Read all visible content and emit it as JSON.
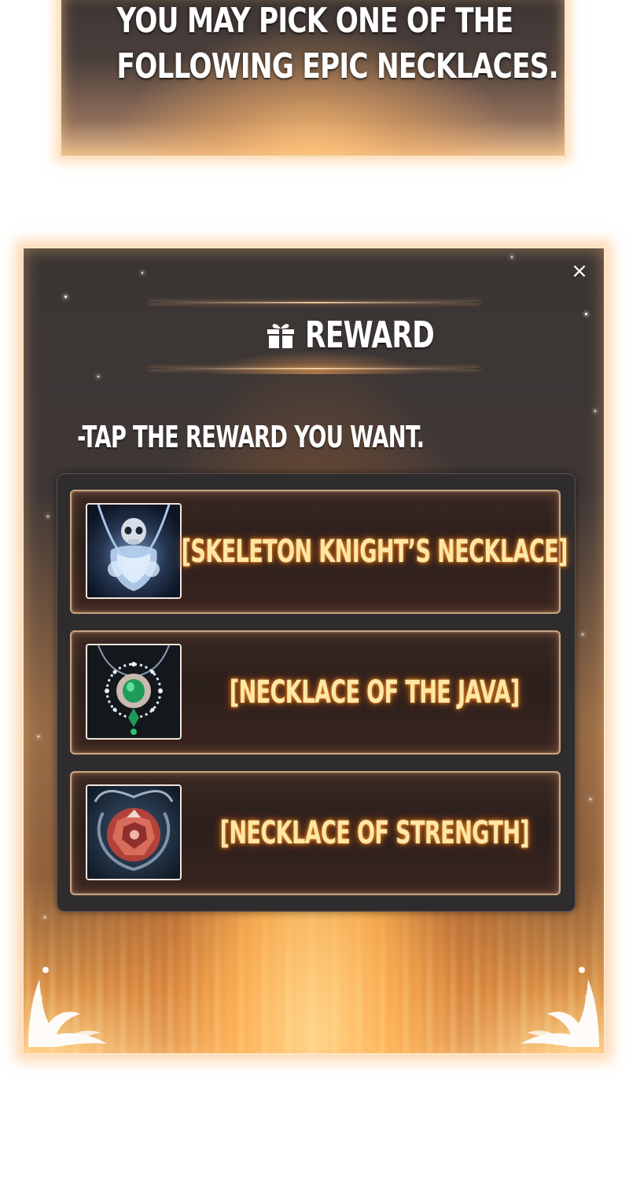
{
  "message": {
    "lines": [
      "YOU MAY PICK ONE OF THE",
      "FOLLOWING EPIC NECKLACES."
    ]
  },
  "reward_window": {
    "close_symbol": "×",
    "title": "REWARD",
    "title_icon": "gift-icon",
    "instruction": "-TAP THE REWARD YOU WANT.",
    "items": [
      {
        "label": "[SKELETON KNIGHT’S NECKLACE]",
        "icon": "skeleton-necklace-icon"
      },
      {
        "label": "[NECKLACE OF THE JAVA]",
        "icon": "emerald-necklace-icon"
      },
      {
        "label": "[NECKLACE OF STRENGTH]",
        "icon": "red-gem-necklace-icon"
      }
    ]
  },
  "colors": {
    "window_dark": "#3a3534",
    "glow_orange": "#ffb050",
    "item_label": "#ffe7a6",
    "border_light": "#fbe6c8"
  }
}
